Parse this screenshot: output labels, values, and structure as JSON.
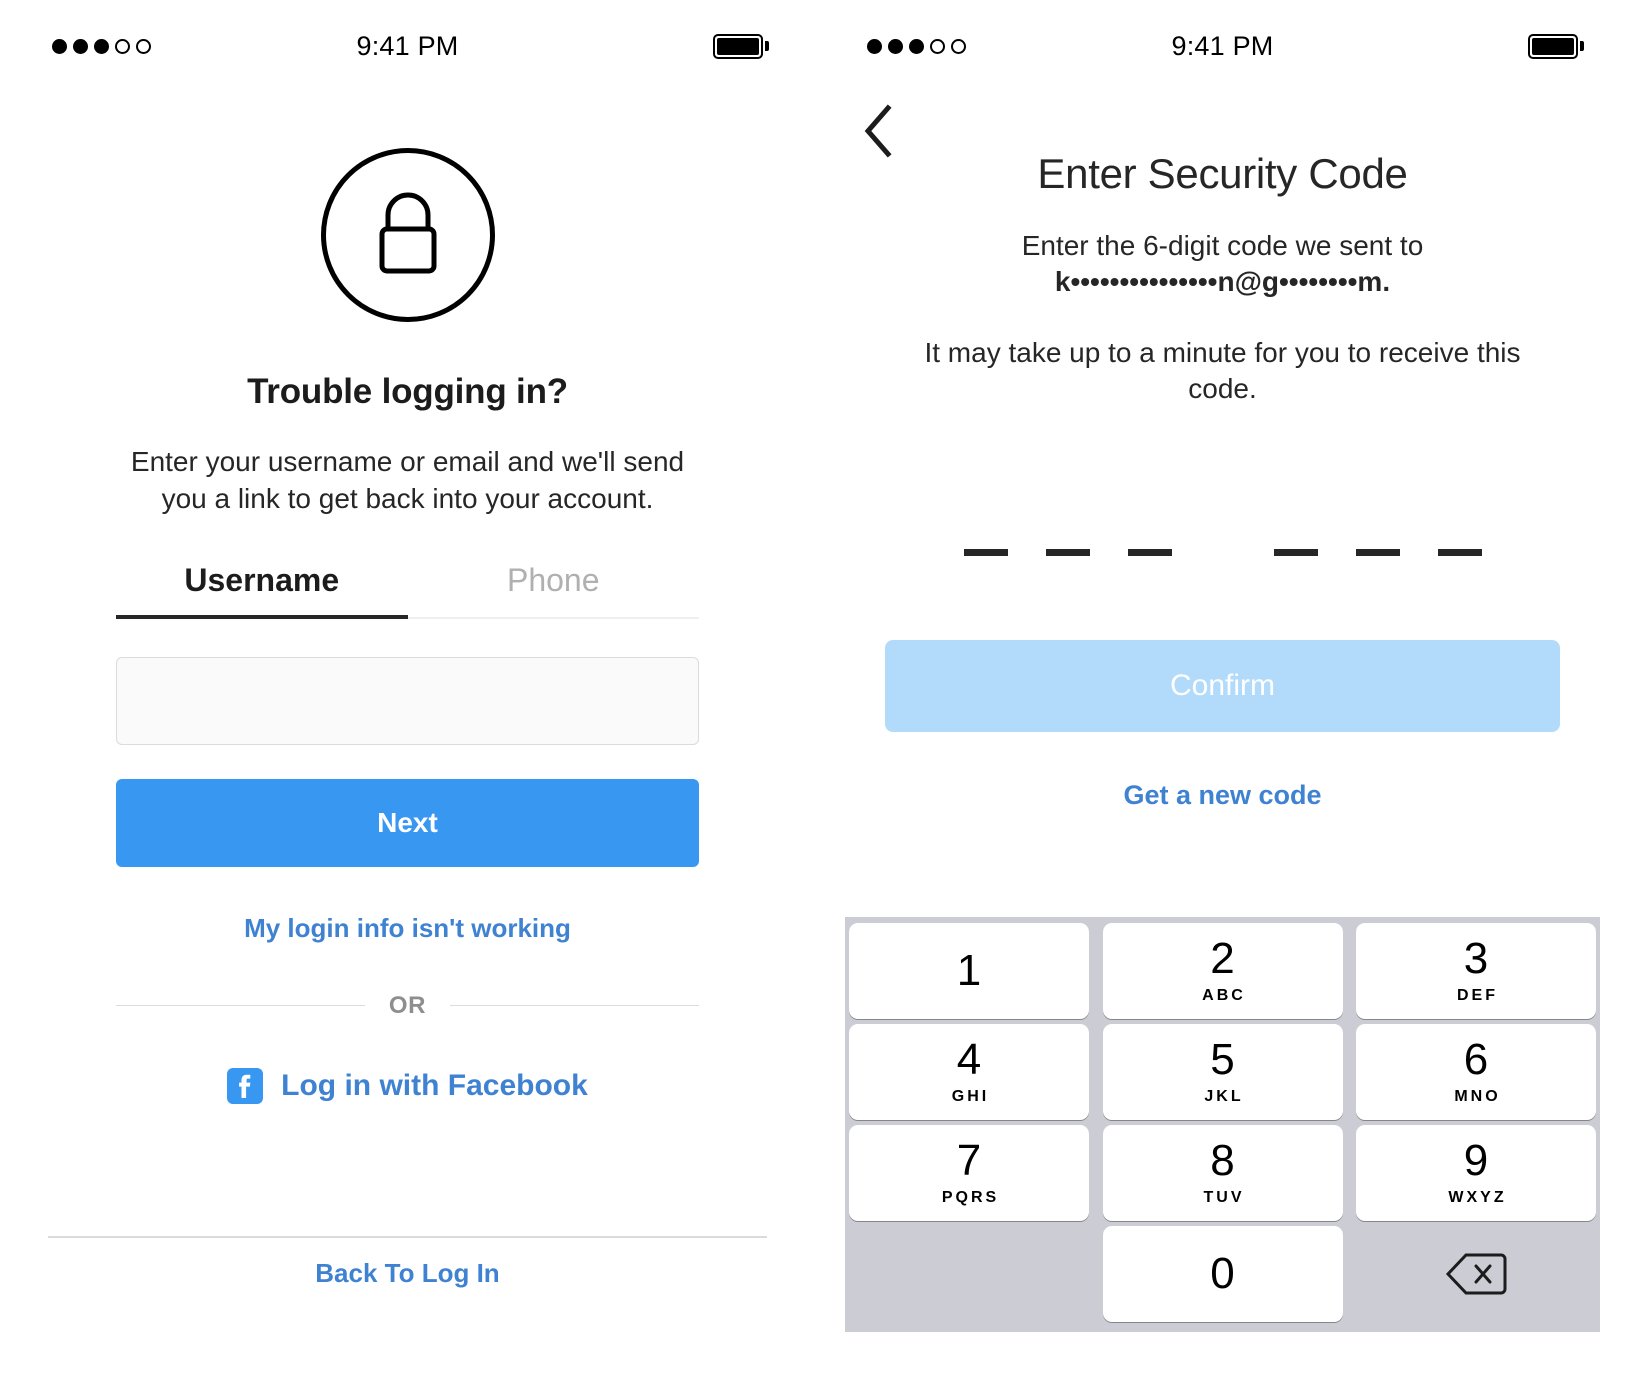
{
  "statusbar": {
    "time": "9:41 PM",
    "signal_dots": [
      "on",
      "on",
      "on",
      "off",
      "off"
    ]
  },
  "left_screen": {
    "lock_icon": "lock-icon",
    "title": "Trouble logging in?",
    "subtitle": "Enter your username or email and we'll send you a link to get back into your account.",
    "tabs": [
      {
        "label": "Username",
        "state": "active"
      },
      {
        "label": "Phone",
        "state": "inactive"
      }
    ],
    "input": {
      "value": "",
      "placeholder": ""
    },
    "next_button": "Next",
    "help_link": "My login info isn't working",
    "or_divider": "OR",
    "facebook": {
      "icon": "facebook-icon",
      "label": "Log in with Facebook"
    },
    "back_to_login": "Back To Log In"
  },
  "right_screen": {
    "back_icon": "chevron-left-icon",
    "title": "Enter Security Code",
    "sent_to_line1": "Enter the 6-digit code we sent to",
    "sent_to_masked": "k•••••••••••••••n@g••••••••m.",
    "may_take": "It may take up to a minute for you to receive this code.",
    "code_cells": [
      "",
      "",
      "",
      "",
      "",
      ""
    ],
    "confirm_button": "Confirm",
    "get_new_code": "Get a new code",
    "keypad": {
      "keys": [
        {
          "num": "1",
          "letters": ""
        },
        {
          "num": "2",
          "letters": "ABC"
        },
        {
          "num": "3",
          "letters": "DEF"
        },
        {
          "num": "4",
          "letters": "GHI"
        },
        {
          "num": "5",
          "letters": "JKL"
        },
        {
          "num": "6",
          "letters": "MNO"
        },
        {
          "num": "7",
          "letters": "PQRS"
        },
        {
          "num": "8",
          "letters": "TUV"
        },
        {
          "num": "9",
          "letters": "WXYZ"
        },
        {
          "num": "0",
          "letters": ""
        }
      ],
      "delete_icon": "backspace-icon"
    }
  },
  "colors": {
    "accent_blue": "#3897f0",
    "link_blue": "#3f82d2",
    "disabled_blue": "#b2dbfb",
    "keypad_bg": "#ccccd4",
    "text_dark": "#262626",
    "text_muted": "#8e8e8e",
    "border_light": "#dbdbdb"
  }
}
